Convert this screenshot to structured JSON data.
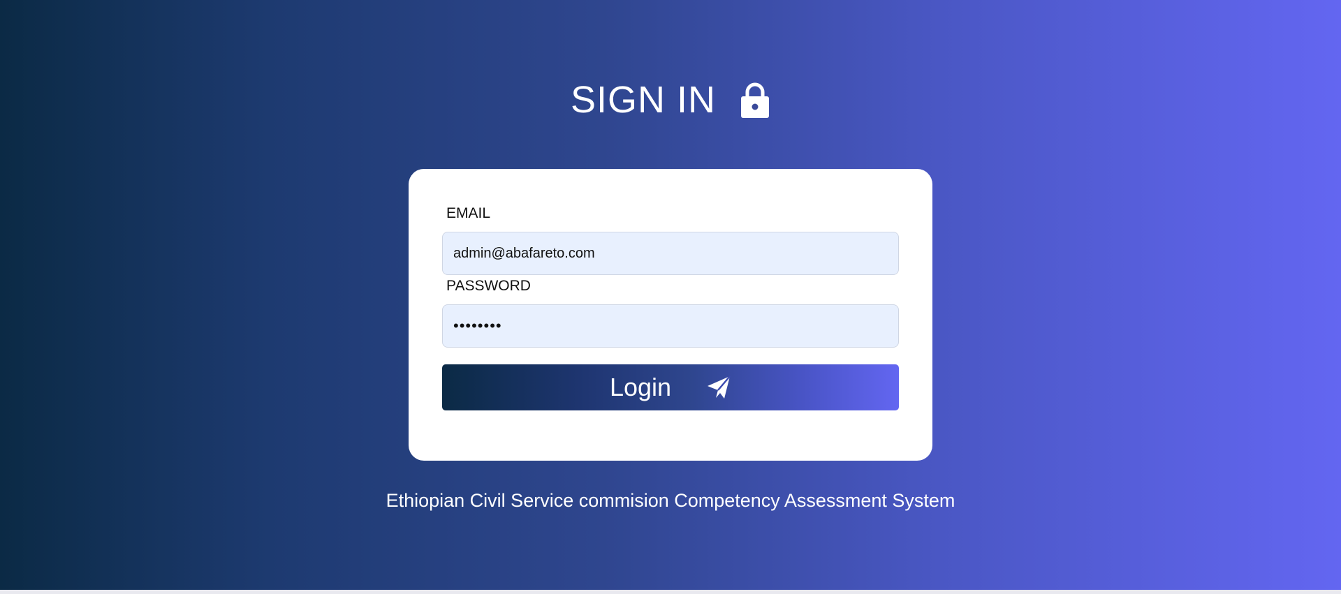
{
  "header": {
    "title": "SIGN IN",
    "icon": "lock-icon"
  },
  "form": {
    "email_label": "EMAIL",
    "email_value": "admin@abafareto.com",
    "password_label": "PASSWORD",
    "password_value": "••••••••",
    "login_label": "Login",
    "login_icon": "send-icon"
  },
  "footer": {
    "text": "Ethiopian Civil Service commision Competency Assessment System"
  },
  "colors": {
    "gradient_start": "#0b2a45",
    "gradient_end": "#6366f1",
    "input_background": "#e8f0fe",
    "card_background": "#ffffff"
  }
}
